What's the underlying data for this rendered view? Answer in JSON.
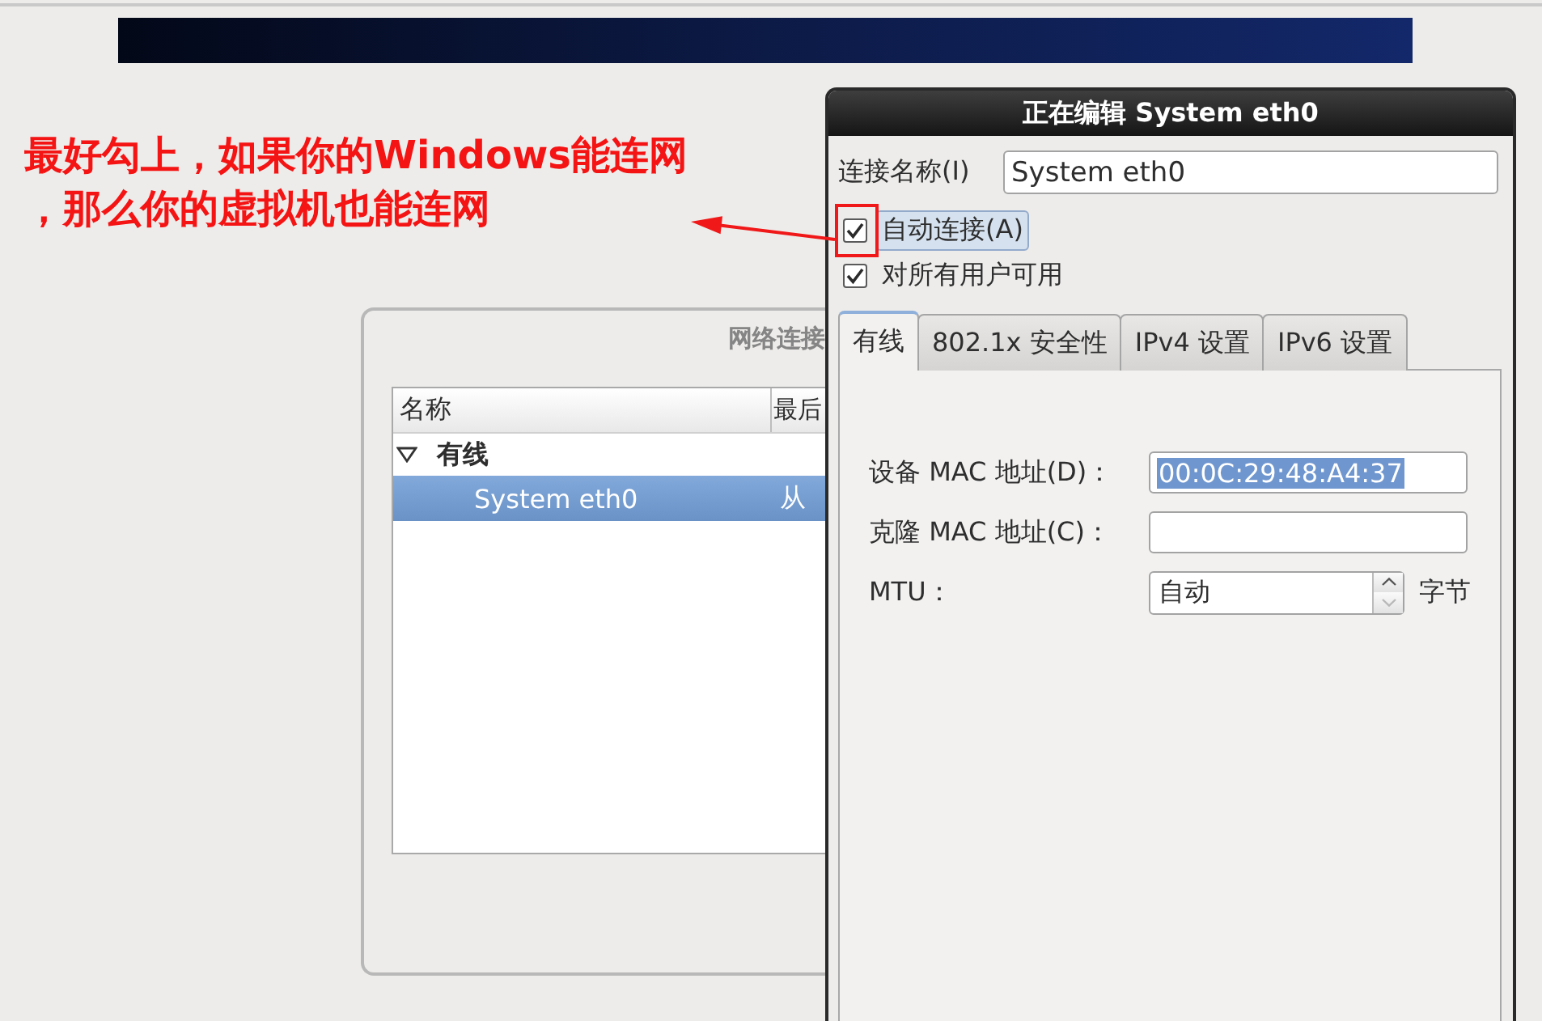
{
  "annotation": {
    "lines": [
      "最好勾上，如果你的Windows能连网",
      "，那么你的虚拟机也能连网"
    ]
  },
  "background_window": {
    "title": "网络连接",
    "columns": [
      "名称",
      "最后"
    ],
    "groups": [
      {
        "label": "有线",
        "expanded": true,
        "children": [
          {
            "name": "System eth0",
            "column_2": "从",
            "selected": true
          }
        ]
      }
    ]
  },
  "dialog": {
    "title": "正在编辑 System eth0",
    "name_field": {
      "label": "连接名称(I)",
      "value": "System eth0"
    },
    "checkboxes": [
      {
        "label": "自动连接(A)",
        "checked": true,
        "focused": true
      },
      {
        "label": "对所有用户可用",
        "checked": true,
        "focused": false
      }
    ],
    "tabs": [
      {
        "label": "有线",
        "selected": true
      },
      {
        "label": "802.1x 安全性",
        "selected": false
      },
      {
        "label": "IPv4 设置",
        "selected": false
      },
      {
        "label": "IPv6 设置",
        "selected": false
      }
    ],
    "fields": [
      {
        "kind": "text",
        "label": "设备 MAC 地址(D)：",
        "value": "00:0C:29:48:A4:37",
        "highlighted": true
      },
      {
        "kind": "text",
        "label": "克隆 MAC 地址(C)："
      },
      {
        "kind": "spin",
        "label": "MTU：",
        "value": "自动",
        "highlighted": false,
        "unit": "字节",
        "can_decrease": false
      }
    ]
  }
}
